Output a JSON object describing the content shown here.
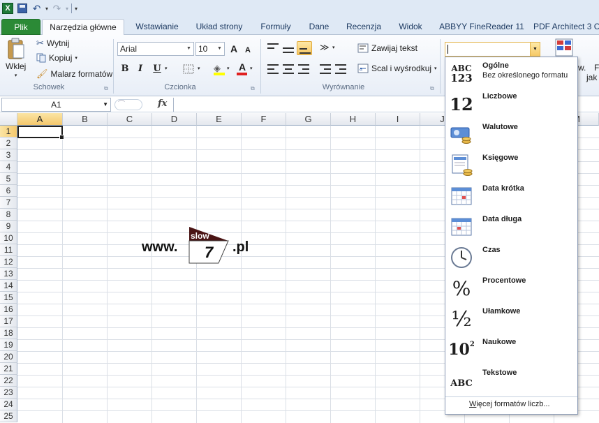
{
  "qat": {
    "undo_symbol": "↶",
    "redo_symbol": "↷",
    "dropdown_symbol": "▾",
    "customize_symbol": "▾"
  },
  "tabs": [
    {
      "label": "Plik"
    },
    {
      "label": "Narzędzia główne"
    },
    {
      "label": "Wstawianie"
    },
    {
      "label": "Układ strony"
    },
    {
      "label": "Formuły"
    },
    {
      "label": "Dane"
    },
    {
      "label": "Recenzja"
    },
    {
      "label": "Widok"
    },
    {
      "label": "ABBYY FineReader 11"
    },
    {
      "label": "PDF Architect 3 Cr"
    }
  ],
  "ribbon": {
    "clipboard": {
      "paste": "Wklej",
      "cut": "Wytnij",
      "copy": "Kopiuj",
      "painter": "Malarz formatów",
      "group": "Schowek"
    },
    "font": {
      "family": "Arial",
      "size": "10",
      "bold": "B",
      "italic": "I",
      "underline": "U",
      "grow": "A",
      "shrink": "A",
      "font_color_letter": "A",
      "group": "Czcionka"
    },
    "alignment": {
      "wrap": "Zawijaj tekst",
      "merge": "Scal i wyśrodkuj",
      "group": "Wyrównanie"
    },
    "right_cut": {
      "a": "w.",
      "b": "F",
      "c": "jak"
    }
  },
  "formula_bar": {
    "name_box": "A1",
    "fx": "fx"
  },
  "grid": {
    "columns": [
      "A",
      "B",
      "C",
      "D",
      "E",
      "F",
      "G",
      "H",
      "I",
      "J",
      "K",
      "L",
      "M"
    ],
    "rows": [
      "1",
      "2",
      "3",
      "4",
      "5",
      "6",
      "7",
      "8",
      "9",
      "10",
      "11",
      "12",
      "13",
      "14",
      "15",
      "16",
      "17",
      "18",
      "19",
      "20",
      "21",
      "22",
      "23",
      "24",
      "25"
    ]
  },
  "watermark": {
    "www": "www.",
    "slow": "slow",
    "seven": "7",
    "pl": ".pl"
  },
  "number_format_menu": {
    "items": [
      {
        "name": "Ogólne",
        "sub": "Bez określonego formatu",
        "icon": "abc-123-icon"
      },
      {
        "name": "Liczbowe",
        "sub": "",
        "icon": "number-12-icon"
      },
      {
        "name": "Walutowe",
        "sub": "",
        "icon": "currency-icon"
      },
      {
        "name": "Księgowe",
        "sub": "",
        "icon": "accounting-icon"
      },
      {
        "name": "Data krótka",
        "sub": "",
        "icon": "calendar-icon"
      },
      {
        "name": "Data długa",
        "sub": "",
        "icon": "calendar-icon"
      },
      {
        "name": "Czas",
        "sub": "",
        "icon": "clock-icon"
      },
      {
        "name": "Procentowe",
        "sub": "",
        "icon": "percent-icon"
      },
      {
        "name": "Ułamkowe",
        "sub": "",
        "icon": "fraction-icon"
      },
      {
        "name": "Naukowe",
        "sub": "",
        "icon": "scientific-icon"
      },
      {
        "name": "Tekstowe",
        "sub": "",
        "icon": "text-abc-icon"
      }
    ],
    "icon_text": {
      "abc": "ABC",
      "n123": "123",
      "n12": "12",
      "pct": "%",
      "frac": "½",
      "sci_base": "10",
      "sci_exp": "2",
      "txt": "ABC"
    },
    "more_prefix": "W",
    "more_rest": "ięcej formatów liczb..."
  },
  "colors": {
    "file_tab": "#2b8a36",
    "selection_header": "#f4c86d",
    "ribbon_bg": "#e8eef7"
  }
}
